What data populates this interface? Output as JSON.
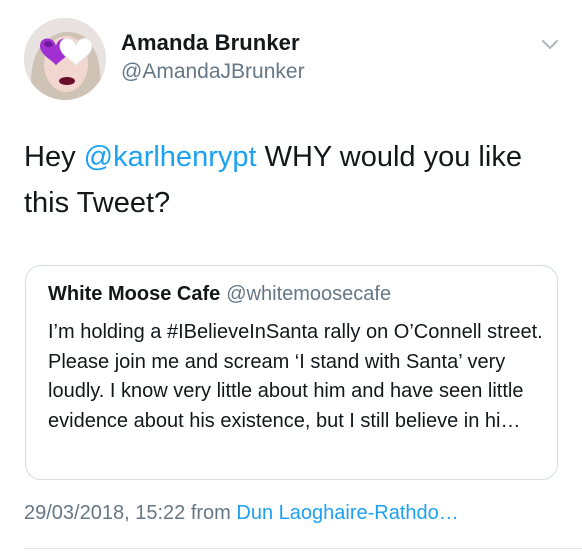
{
  "author": {
    "name": "Amanda Brunker",
    "handle": "@AmandaJBrunker",
    "avatar_icon": "avatar-heart-sunglasses"
  },
  "tweet": {
    "prefix": "Hey ",
    "mention": "@karlhenrypt",
    "suffix": " WHY would you like this Tweet?"
  },
  "quoted_tweet": {
    "name": "White Moose Cafe",
    "handle": "@whitemoosecafe",
    "text": "I’m holding a #IBelieveInSanta rally on O’Connell street. Please join me and scream ‘I stand with Santa’ very loudly. I know very little about him and have seen little evidence about his existence, but I still believe in hi…"
  },
  "meta": {
    "timestamp": "29/03/2018, 15:22",
    "from_label": " from ",
    "source": "Dun Laoghaire-Rathdo…"
  },
  "colors": {
    "link": "#1da1f2",
    "secondary_text": "#657786",
    "primary_text": "#14171a",
    "border": "#d7dce0"
  },
  "icons": {
    "menu": "chevron-down-icon"
  }
}
